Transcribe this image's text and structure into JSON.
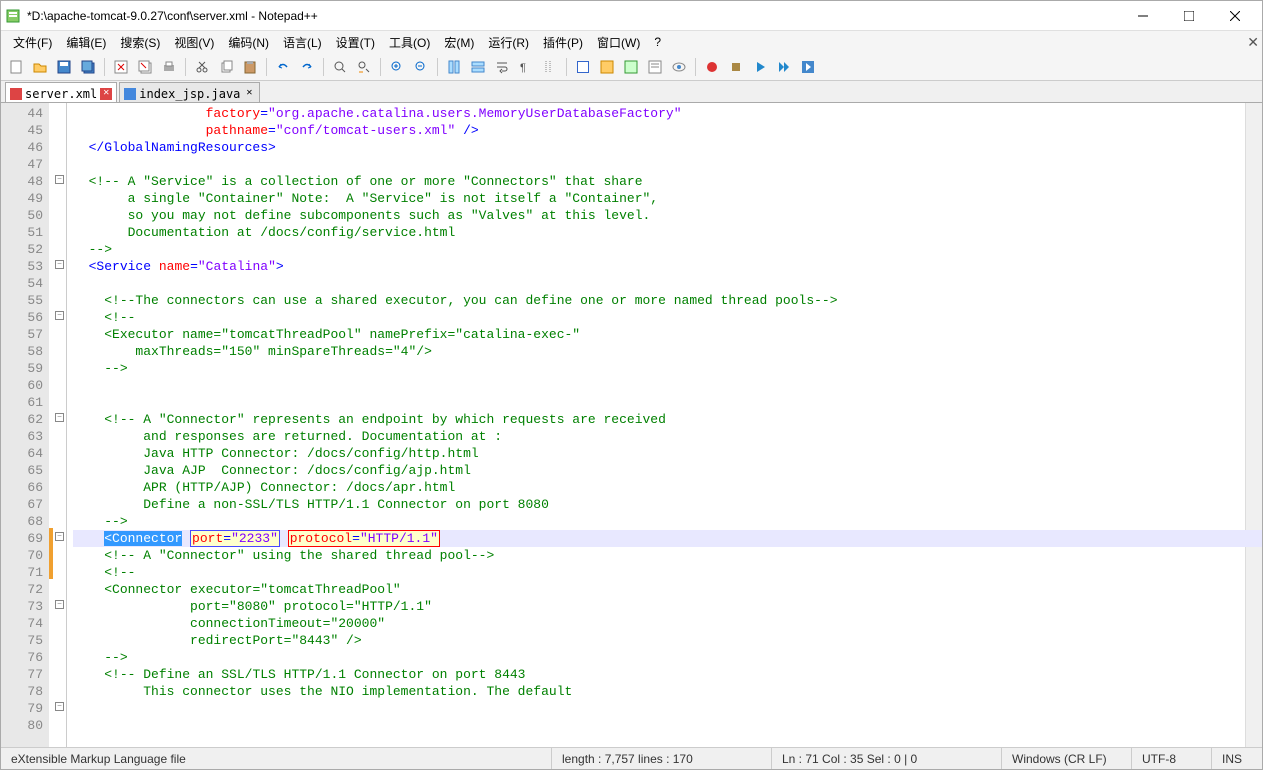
{
  "title": "*D:\\apache-tomcat-9.0.27\\conf\\server.xml - Notepad++",
  "menu": [
    "文件(F)",
    "编辑(E)",
    "搜索(S)",
    "视图(V)",
    "编码(N)",
    "语言(L)",
    "设置(T)",
    "工具(O)",
    "宏(M)",
    "运行(R)",
    "插件(P)",
    "窗口(W)",
    "?"
  ],
  "tabs": [
    {
      "label": "server.xml",
      "active": true
    },
    {
      "label": "index_jsp.java",
      "active": false
    }
  ],
  "lines": {
    "start": 44,
    "end": 80
  },
  "code": {
    "l44": {
      "indent": "                 ",
      "a1": "factory",
      "v1": "\"org.apache.catalina.users.MemoryUserDatabaseFactory\""
    },
    "l45": {
      "indent": "                 ",
      "a1": "pathname",
      "v1": "\"conf/tomcat-users.xml\"",
      "end": " />"
    },
    "l46": {
      "close": "</GlobalNamingResources>"
    },
    "l48": {
      "cmt": "<!-- A \"Service\" is a collection of one or more \"Connectors\" that share"
    },
    "l49": {
      "cmt": "     a single \"Container\" Note:  A \"Service\" is not itself a \"Container\","
    },
    "l50": {
      "cmt": "     so you may not define subcomponents such as \"Valves\" at this level."
    },
    "l51": {
      "cmt": "     Documentation at /docs/config/service.html"
    },
    "l52": {
      "cmt": "-->"
    },
    "l53": {
      "tag": "Service",
      "a1": "name",
      "v1": "\"Catalina\""
    },
    "l55": {
      "cmt": "<!--The connectors can use a shared executor, you can define one or more named thread pools-->"
    },
    "l56": {
      "cmt": "<!--"
    },
    "l57": {
      "cmt": "<Executor name=\"tomcatThreadPool\" namePrefix=\"catalina-exec-\""
    },
    "l58": {
      "cmt": "    maxThreads=\"150\" minSpareThreads=\"4\"/>"
    },
    "l59": {
      "cmt": "-->"
    },
    "l62": {
      "cmt": "<!-- A \"Connector\" represents an endpoint by which requests are received"
    },
    "l63": {
      "cmt": "     and responses are returned. Documentation at :"
    },
    "l64": {
      "cmt": "     Java HTTP Connector: /docs/config/http.html"
    },
    "l65": {
      "cmt": "     Java AJP  Connector: /docs/config/ajp.html"
    },
    "l66": {
      "cmt": "     APR (HTTP/AJP) Connector: /docs/apr.html"
    },
    "l67": {
      "cmt": "     Define a non-SSL/TLS HTTP/1.1 Connector on port 8080"
    },
    "l68": {
      "cmt": "-->"
    },
    "l69": {
      "tag": "Connector",
      "a1": "port",
      "v1": "\"2233\"",
      "a2": "protocol",
      "v2": "\"HTTP/1.1\""
    },
    "l70": {
      "a1": "connectionTimeout",
      "v1": "\"20000\""
    },
    "l71": {
      "a1": "redirectPort",
      "v1": "\"8443\"",
      "end": "/>"
    },
    "l72": {
      "cmt": "<!-- A \"Connector\" using the shared thread pool-->"
    },
    "l73": {
      "cmt": "<!--"
    },
    "l74": {
      "cmt": "<Connector executor=\"tomcatThreadPool\""
    },
    "l75": {
      "cmt": "           port=\"8080\" protocol=\"HTTP/1.1\""
    },
    "l76": {
      "cmt": "           connectionTimeout=\"20000\""
    },
    "l77": {
      "cmt": "           redirectPort=\"8443\" />"
    },
    "l78": {
      "cmt": "-->"
    },
    "l79": {
      "cmt": "<!-- Define an SSL/TLS HTTP/1.1 Connector on port 8443"
    },
    "l80": {
      "cmt": "     This connector uses the NIO implementation. The default"
    }
  },
  "status": {
    "filetype": "eXtensible Markup Language file",
    "length": "length : 7,757    lines : 170",
    "pos": "Ln : 71    Col : 35    Sel : 0 | 0",
    "eol": "Windows (CR LF)",
    "enc": "UTF-8",
    "mode": "INS"
  }
}
